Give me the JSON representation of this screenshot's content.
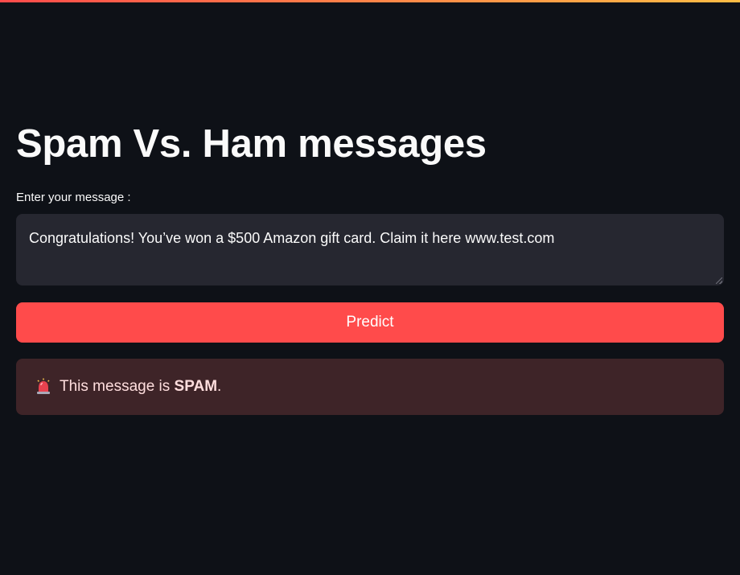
{
  "page": {
    "title": "Spam Vs. Ham messages"
  },
  "form": {
    "label": "Enter your message :",
    "message_value": "Congratulations! You’ve won a $500 Amazon gift card. Claim it here www.test.com",
    "button_label": "Predict"
  },
  "result": {
    "icon": "police-siren-icon",
    "prefix": "This message is ",
    "verdict": "SPAM",
    "suffix": "."
  },
  "colors": {
    "background": "#0e1117",
    "button": "#ff4b4b",
    "alert_background": "#3e2428",
    "input_background": "#262730"
  }
}
